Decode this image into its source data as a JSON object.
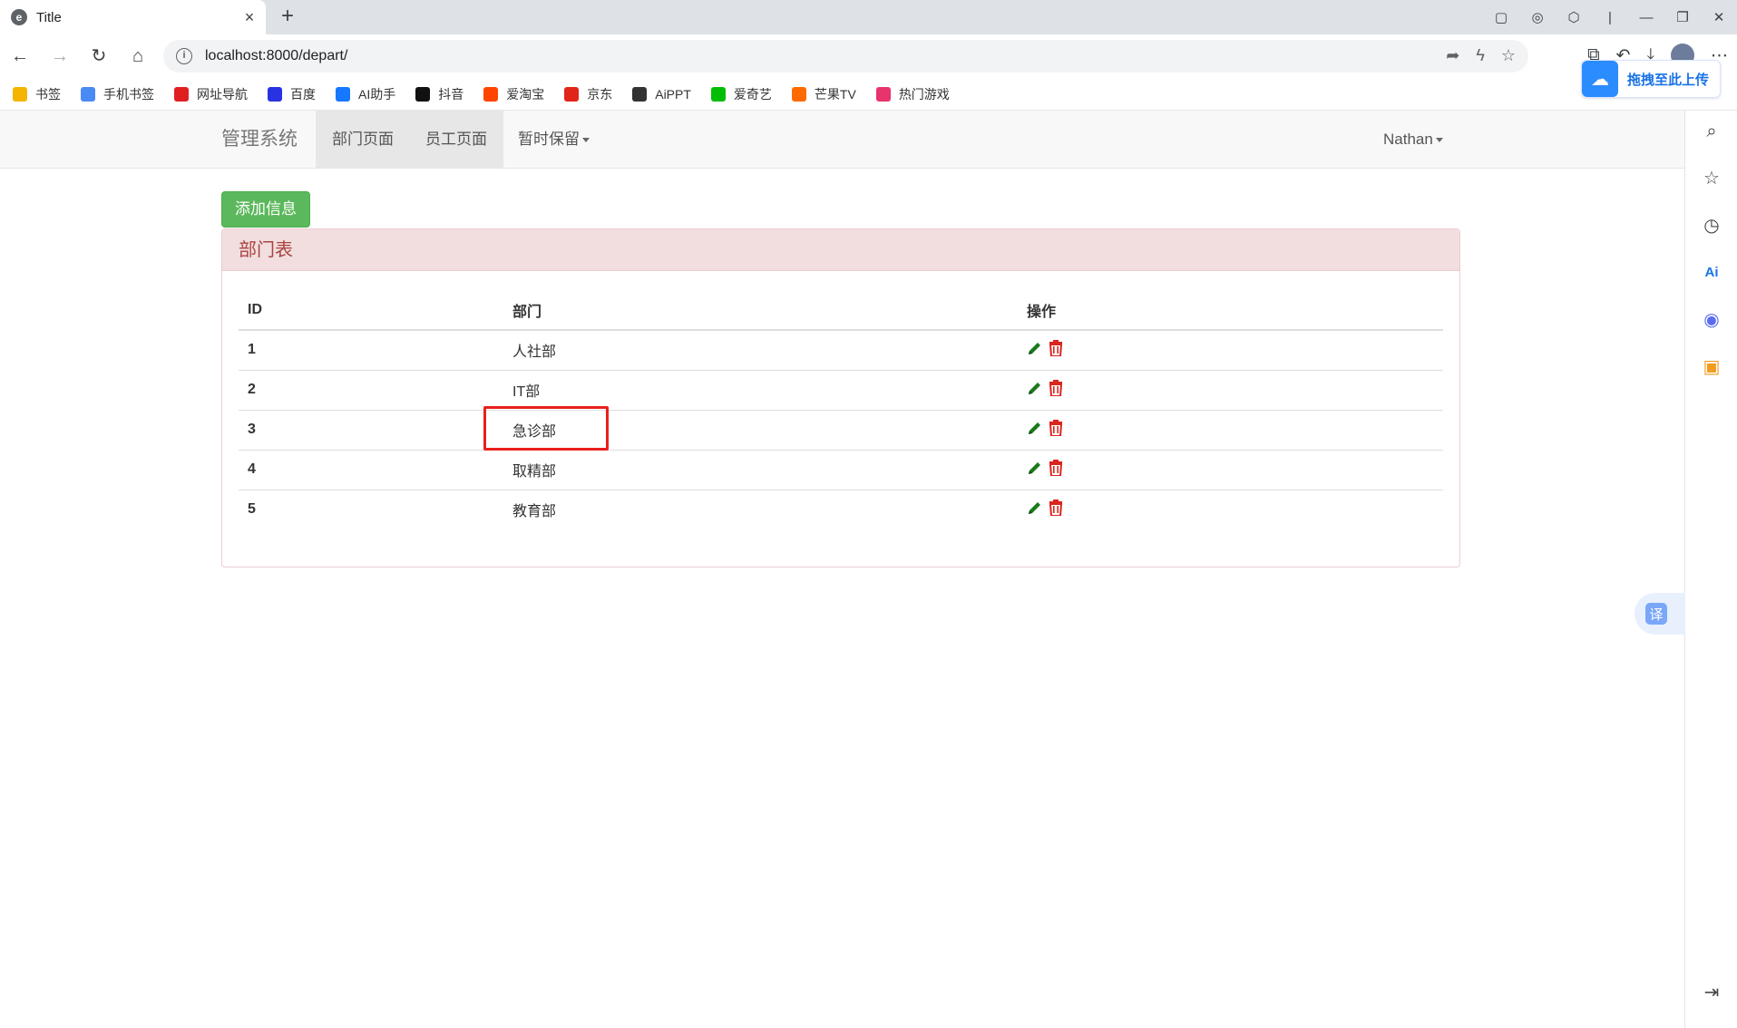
{
  "browser": {
    "tab_title": "Title",
    "tab_close": "×",
    "new_tab": "+",
    "url": "localhost:8000/depart/",
    "bookmarks": [
      {
        "label": "书签",
        "color": "#f5b400"
      },
      {
        "label": "手机书签",
        "color": "#4a8af4"
      },
      {
        "label": "网址导航",
        "color": "#e02020"
      },
      {
        "label": "百度",
        "color": "#2932e1"
      },
      {
        "label": "AI助手",
        "color": "#1677ff"
      },
      {
        "label": "抖音",
        "color": "#111111"
      },
      {
        "label": "爱淘宝",
        "color": "#ff4400"
      },
      {
        "label": "京东",
        "color": "#e1251b"
      },
      {
        "label": "AiPPT",
        "color": "#333333"
      },
      {
        "label": "爱奇艺",
        "color": "#00be06"
      },
      {
        "label": "芒果TV",
        "color": "#ff6a00"
      },
      {
        "label": "热门游戏",
        "color": "#e8336d"
      }
    ],
    "upload_label": "拖拽至此上传"
  },
  "navbar": {
    "brand": "管理系统",
    "items": [
      {
        "label": "部门页面",
        "active": true
      },
      {
        "label": "员工页面",
        "active": true
      },
      {
        "label": "暂时保留",
        "dropdown": true
      }
    ],
    "user": "Nathan"
  },
  "content": {
    "add_button": "添加信息",
    "panel_title": "部门表",
    "table": {
      "headers": [
        "ID",
        "部门",
        "操作"
      ],
      "rows": [
        {
          "id": "1",
          "name": "人社部"
        },
        {
          "id": "2",
          "name": "IT部"
        },
        {
          "id": "3",
          "name": "急诊部"
        },
        {
          "id": "4",
          "name": "取精部"
        },
        {
          "id": "5",
          "name": "教育部"
        }
      ]
    },
    "edit_color": "#1a7a1a",
    "delete_color": "#d9251d",
    "highlight_color": "#e8201c"
  },
  "sidebar_icons": [
    "search-icon",
    "star-icon",
    "clock-icon",
    "ai-icon",
    "gamepad-icon",
    "briefcase-icon",
    "collapse-icon"
  ],
  "translate_label": "译"
}
